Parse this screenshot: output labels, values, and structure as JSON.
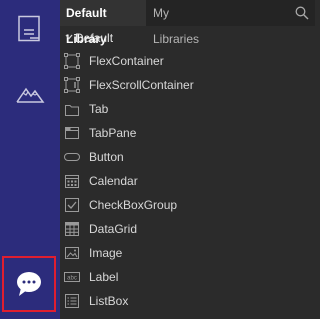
{
  "tabs": {
    "default_label": "Default Library",
    "my_label": "My Libraries"
  },
  "group": {
    "label": "Default"
  },
  "items": [
    {
      "label": "FlexContainer",
      "icon": "flex-container-icon"
    },
    {
      "label": "FlexScrollContainer",
      "icon": "flex-scroll-container-icon"
    },
    {
      "label": "Tab",
      "icon": "tab-icon"
    },
    {
      "label": "TabPane",
      "icon": "tabpane-icon"
    },
    {
      "label": "Button",
      "icon": "button-icon"
    },
    {
      "label": "Calendar",
      "icon": "calendar-icon"
    },
    {
      "label": "CheckBoxGroup",
      "icon": "checkbox-group-icon"
    },
    {
      "label": "DataGrid",
      "icon": "datagrid-icon"
    },
    {
      "label": "Image",
      "icon": "image-icon"
    },
    {
      "label": "Label",
      "icon": "label-icon"
    },
    {
      "label": "ListBox",
      "icon": "listbox-icon"
    }
  ],
  "label_icon_text": "abc",
  "colors": {
    "rail": "#2c2c7c",
    "panel": "#2b2b2b",
    "highlight": "#e01e2f"
  }
}
